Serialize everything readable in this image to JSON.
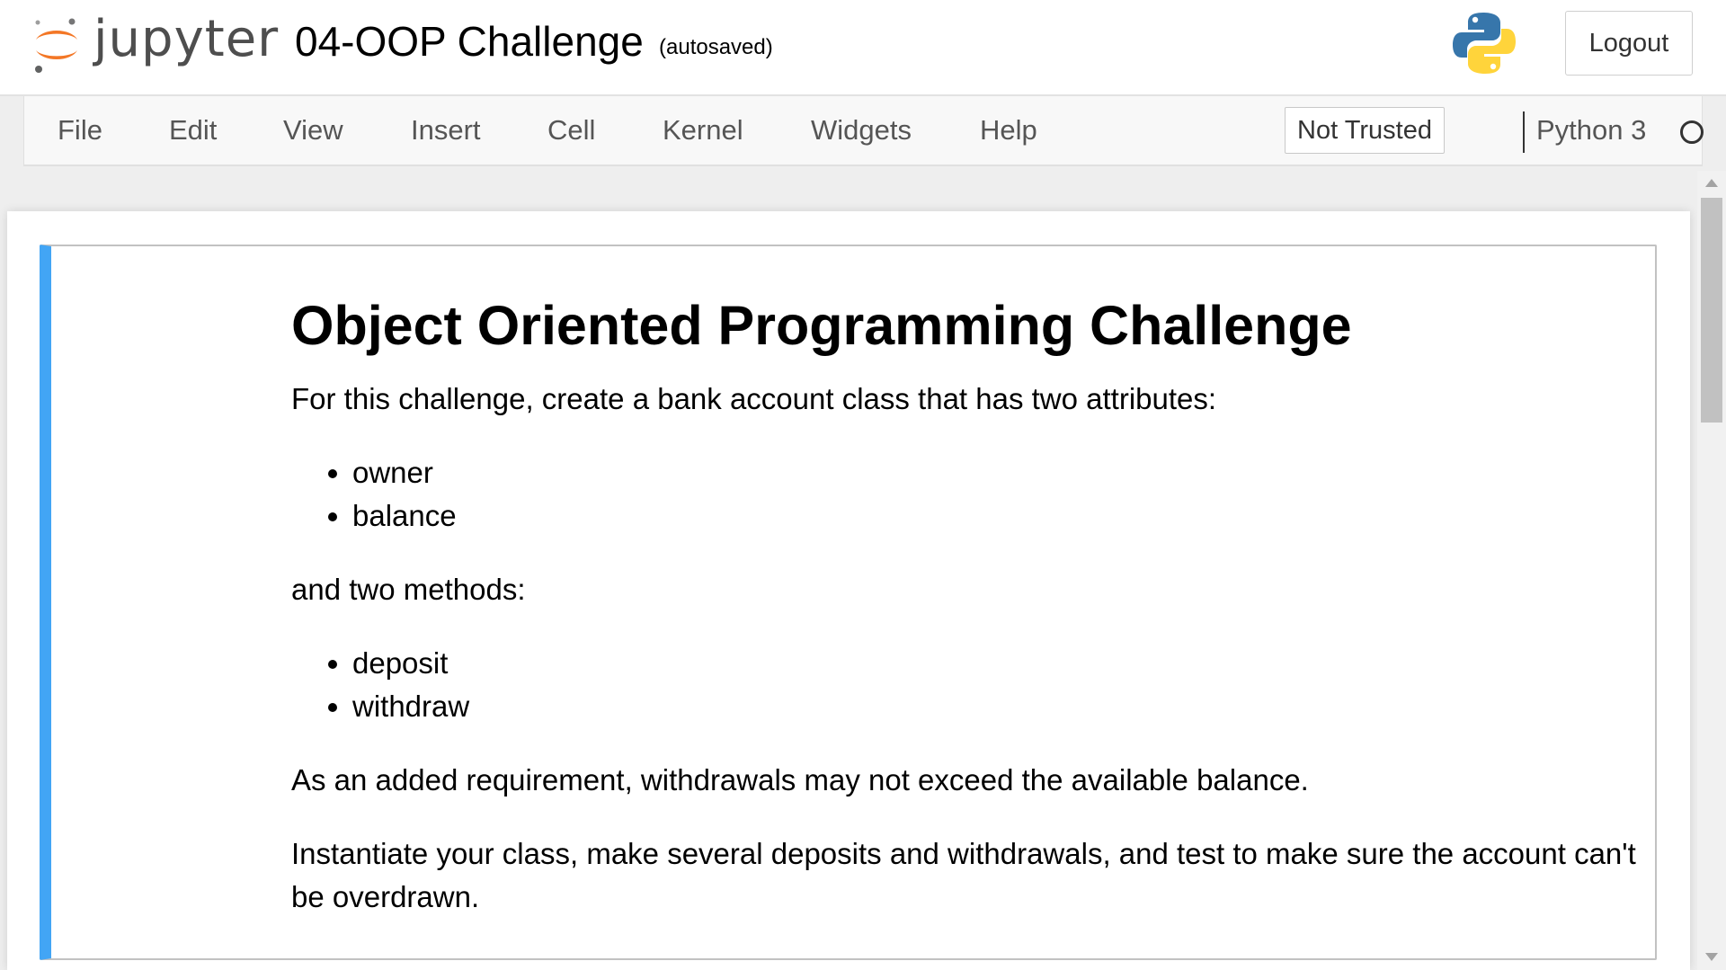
{
  "header": {
    "logo_text": "jupyter",
    "notebook_title": "04-OOP Challenge",
    "autosave_status": "(autosaved)",
    "logout_label": "Logout"
  },
  "menu": {
    "items": [
      "File",
      "Edit",
      "View",
      "Insert",
      "Cell",
      "Kernel",
      "Widgets",
      "Help"
    ],
    "trust_status": "Not Trusted",
    "kernel_name": "Python 3"
  },
  "cell": {
    "heading": "Object Oriented Programming Challenge",
    "intro": "For this challenge, create a bank account class that has two attributes:",
    "attributes": [
      "owner",
      "balance"
    ],
    "methods_intro": "and two methods:",
    "methods": [
      "deposit",
      "withdraw"
    ],
    "requirement": "As an added requirement, withdrawals may not exceed the available balance.",
    "instructions": "Instantiate your class, make several deposits and withdrawals, and test to make sure the account can't be overdrawn."
  },
  "colors": {
    "cell_selected_border": "#42a5f5",
    "jupyter_orange": "#f37726",
    "python_blue": "#3776ab",
    "python_yellow": "#ffd43b"
  }
}
